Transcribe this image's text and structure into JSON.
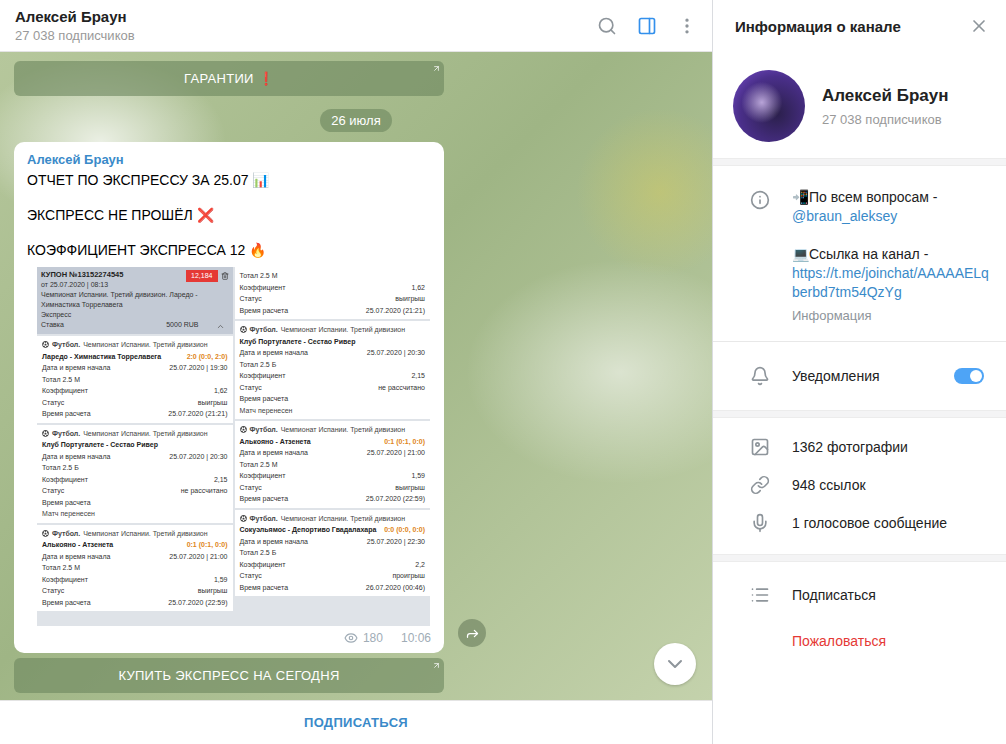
{
  "chat": {
    "title": "Алексей Браун",
    "subtitle": "27 038 подписчиков",
    "sidebar_toggle": {
      "active": true
    }
  },
  "top_button": {
    "label": "ГАРАНТИИ ❗"
  },
  "date": "26 июля",
  "message": {
    "author": "Алексей Браун",
    "lines": [
      "ОТЧЕТ ПО ЭКСПРЕССУ ЗА 25.07 📊",
      "ЭКСПРЕСС НЕ ПРОШЁЛ ❌",
      "КОЭФФИЦИЕНТ ЭКСПРЕССА 12 🔥"
    ],
    "views": "180",
    "time": "10:06"
  },
  "coupon": {
    "header": {
      "number": "КУПОН №13152274545",
      "badge": "12,184",
      "date": "от 25.07.2020 | 08:13",
      "event": "Чемпионат Испании. Третий дивизион. Ларедо - Химнастика Торрелавега",
      "type": "Экспресс",
      "stake_label": "Ставка",
      "stake": "5000 RUB"
    },
    "left": [
      {
        "sport": "Футбол.",
        "league": "Чемпионат Испании. Третий дивизион",
        "match": "Ларедо - Химнастика Торрелавега",
        "score": "2:0 (0:0, 2:0)",
        "rows": [
          {
            "label": "Дата и время начала",
            "value": "25.07.2020 | 19:30"
          },
          {
            "label": "Тотал 2.5 М"
          },
          {
            "label": "Коэффициент",
            "value": "1,62"
          },
          {
            "label": "Статус",
            "value": "выигрыш"
          },
          {
            "label": "Время расчета",
            "value": "25.07.2020 (21:21)"
          }
        ]
      },
      {
        "sport": "Футбол.",
        "league": "Чемпионат Испании. Третий дивизион",
        "match": "Клуб Португалете - Сестао Ривер",
        "rows": [
          {
            "label": "Дата и время начала",
            "value": "25.07.2020 | 20:30"
          },
          {
            "label": "Тотал 2.5 Б"
          },
          {
            "label": "Коэффициент",
            "value": "2,15"
          },
          {
            "label": "Статус",
            "value": "не рассчитано"
          },
          {
            "label": "Время расчета"
          }
        ],
        "note": "Матч перенесен"
      },
      {
        "sport": "Футбол.",
        "league": "Чемпионат Испании. Третий дивизион",
        "match": "Алькояно - Атзенета",
        "score": "0:1 (0:1, 0:0)",
        "rows": [
          {
            "label": "Дата и время начала",
            "value": "25.07.2020 | 21:00"
          },
          {
            "label": "Тотал 2.5 М"
          },
          {
            "label": "Коэффициент",
            "value": "1,59"
          },
          {
            "label": "Статус",
            "value": "выигрыш"
          },
          {
            "label": "Время расчета",
            "value": "25.07.2020 (22:59)"
          }
        ]
      }
    ],
    "right": [
      {
        "rows": [
          {
            "label": "Тотал 2.5 М"
          },
          {
            "label": "Коэффициент",
            "value": "1,62"
          },
          {
            "label": "Статус",
            "value": "выигрыш"
          },
          {
            "label": "Время расчета",
            "value": "25.07.2020 (21:21)"
          }
        ]
      },
      {
        "sport": "Футбол.",
        "league": "Чемпионат Испании. Третий дивизион",
        "match": "Клуб Португалете - Сестао Ривер",
        "rows": [
          {
            "label": "Дата и время начала",
            "value": "25.07.2020 | 20:30"
          },
          {
            "label": "Тотал 2.5 Б"
          },
          {
            "label": "Коэффициент",
            "value": "2,15"
          },
          {
            "label": "Статус",
            "value": "не рассчитано"
          },
          {
            "label": "Время расчета"
          }
        ],
        "note": "Матч перенесен"
      },
      {
        "sport": "Футбол.",
        "league": "Чемпионат Испании. Третий дивизион",
        "match": "Алькояно - Атзенета",
        "score": "0:1 (0:1, 0:0)",
        "rows": [
          {
            "label": "Дата и время начала",
            "value": "25.07.2020 | 21:00"
          },
          {
            "label": "Тотал 2.5 М"
          },
          {
            "label": "Коэффициент",
            "value": "1,59"
          },
          {
            "label": "Статус",
            "value": "выигрыш"
          },
          {
            "label": "Время расчета",
            "value": "25.07.2020 (22:59)"
          }
        ]
      },
      {
        "sport": "Футбол.",
        "league": "Чемпионат Испании. Третий дивизион",
        "match": "Сокуэльямос - Депортиво Гвадалахара",
        "score": "0:0 (0:0, 0:0)",
        "rows": [
          {
            "label": "Дата и время начала",
            "value": "25.07.2020 | 22:30"
          },
          {
            "label": "Тотал 2.5 Б"
          },
          {
            "label": "Коэффициент",
            "value": "2,2"
          },
          {
            "label": "Статус",
            "value": "проигрыш"
          },
          {
            "label": "Время расчета",
            "value": "26.07.2020 (00:46)"
          }
        ]
      }
    ]
  },
  "bottom_button": {
    "label": "КУПИТЬ ЭКСПРЕСС НА СЕГОДНЯ"
  },
  "subscribe_bar": {
    "label": "ПОДПИСАТЬСЯ"
  },
  "info_panel": {
    "title": "Информация о канале",
    "name": "Алексей Браун",
    "subscribers": "27 038 подписчиков",
    "info": {
      "contact_text": "📲По всем вопросам -",
      "contact_link": "@braun_aleksey",
      "link_text": "💻Ссылка на канал -",
      "link": "https://t.me/joinchat/AAAAAELqberbd7tm54QzYg",
      "caption": "Информация"
    },
    "notifications": {
      "label": "Уведомления",
      "on": true
    },
    "media": [
      {
        "label": "1362 фотографии",
        "kind": "photos"
      },
      {
        "label": "948 ссылок",
        "kind": "links"
      },
      {
        "label": "1 голосовое сообщение",
        "kind": "voice"
      }
    ],
    "actions": [
      {
        "label": "Подписаться",
        "kind": "default"
      },
      {
        "label": "Пожаловаться",
        "kind": "danger"
      }
    ]
  }
}
